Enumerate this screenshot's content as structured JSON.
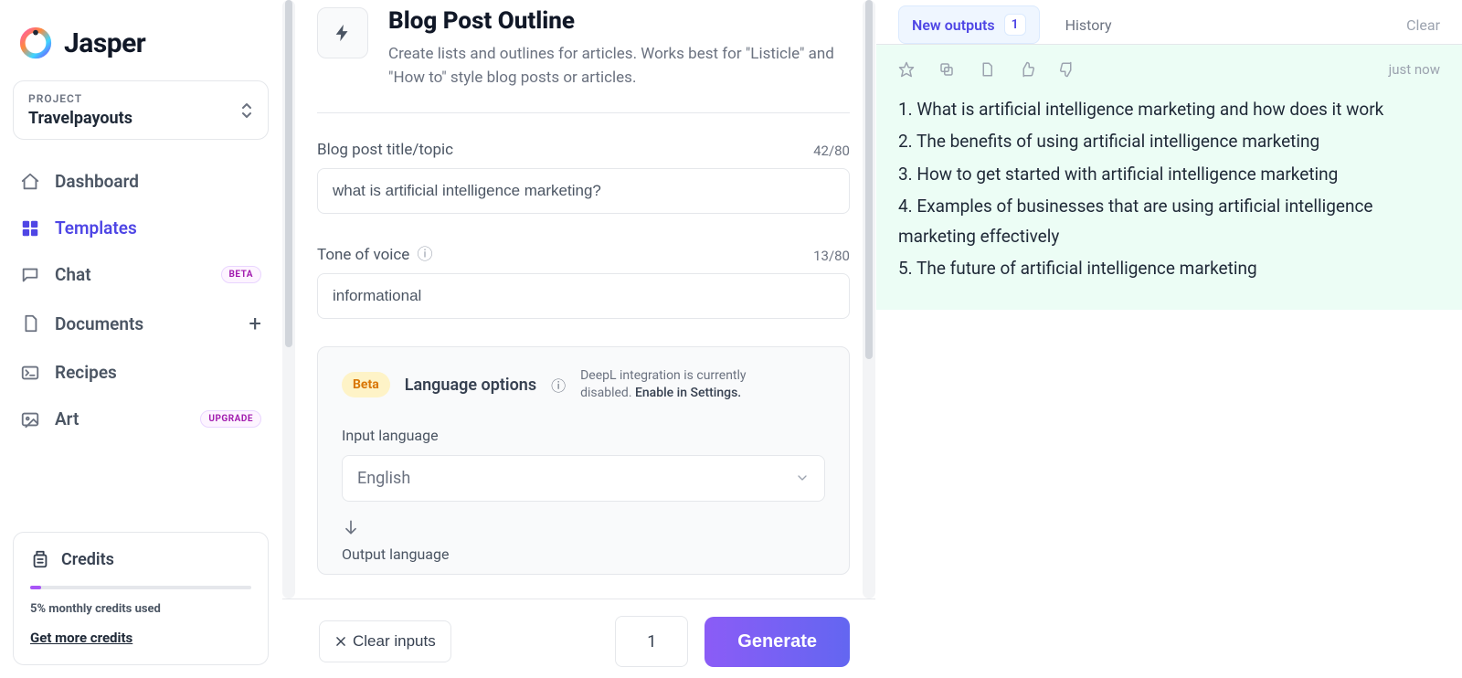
{
  "app": {
    "name": "Jasper"
  },
  "project": {
    "label": "PROJECT",
    "name": "Travelpayouts"
  },
  "nav": {
    "dashboard": "Dashboard",
    "templates": "Templates",
    "chat": "Chat",
    "documents": "Documents",
    "recipes": "Recipes",
    "art": "Art",
    "beta_badge": "BETA",
    "upgrade_badge": "UPGRADE"
  },
  "credits": {
    "title": "Credits",
    "percent_used": 5,
    "subtext": "5% monthly credits used",
    "link": "Get more credits"
  },
  "template": {
    "title": "Blog Post Outline",
    "description": "Create lists and outlines for articles. Works best for \"Listicle\" and \"How to\" style blog posts or articles."
  },
  "fields": {
    "title_label": "Blog post title/topic",
    "title_value": "what is artificial intelligence marketing?",
    "title_count": "42/80",
    "tone_label": "Tone of voice",
    "tone_value": "informational",
    "tone_count": "13/80"
  },
  "language": {
    "beta": "Beta",
    "title": "Language options",
    "note_a": "DeepL integration is currently disabled. ",
    "note_link": "Enable in Settings.",
    "input_label": "Input language",
    "input_value": "English",
    "output_label": "Output language"
  },
  "footer": {
    "clear": "Clear inputs",
    "quantity": "1",
    "generate": "Generate"
  },
  "output": {
    "new_tab": "New outputs",
    "new_count": "1",
    "history_tab": "History",
    "clear": "Clear",
    "timestamp": "just now",
    "items": [
      "1. What is artificial intelligence marketing and how does it work",
      "2. The benefits of using artificial intelligence marketing",
      "3. How to get started with artificial intelligence marketing",
      "4. Examples of businesses that are using artificial intelligence marketing effectively",
      "5. The future of artificial intelligence marketing"
    ]
  }
}
